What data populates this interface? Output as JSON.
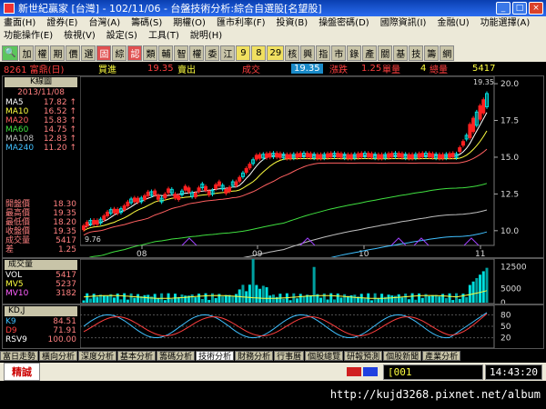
{
  "window": {
    "title": "新世紀贏家 [台灣] - 102/11/06 - 台盤技術分析:綜合自選股[名望股]",
    "min": "_",
    "max": "□",
    "close": "×"
  },
  "menu": [
    "畫面(H)",
    "證券(E)",
    "台灣(A)",
    "籌碼(S)",
    "期權(O)",
    "匯市利率(F)",
    "投資(B)",
    "操盤密碼(D)",
    "國際資訊(I)",
    "金融(U)",
    "功能選擇(A)",
    "功能操作(E)",
    "檢視(V)",
    "設定(S)",
    "工具(T)",
    "說明(H)"
  ],
  "toolbar": [
    "🔍",
    "加",
    "權",
    "期",
    "價",
    "選",
    "固",
    "綜",
    "認",
    "類",
    "輔",
    "智",
    "權",
    "委",
    "江",
    "9",
    "8",
    "29",
    "核",
    "興",
    "指",
    "市",
    "錄",
    "產",
    "關",
    "基",
    "技",
    "籌",
    "網"
  ],
  "quote": {
    "code_name": "8261 富鼎(日)",
    "buy_label": "買進",
    "buy": "19.35",
    "sell_label": "賣出",
    "change_label": "成交",
    "trade": "19.35",
    "change_label2": "漲跌",
    "change": "1.25",
    "vol_label": "單量",
    "vol": "4",
    "total_label": "總量",
    "total": "5417"
  },
  "colors": {
    "ma5": "#ffffff",
    "ma10": "#ffff40",
    "ma20": "#ff6060",
    "ma60": "#40e040",
    "ma108": "#c0c0c0",
    "ma240": "#40c0ff",
    "up": "#ff2020",
    "down": "#00e0e0",
    "k": "#40c0ff",
    "d": "#ff4040"
  },
  "kline": {
    "title": "K線圖",
    "date": "2013/11/08",
    "mas": [
      {
        "name": "MA5",
        "value": "17.82",
        "dir": "↑"
      },
      {
        "name": "MA10",
        "value": "16.52",
        "dir": "↑"
      },
      {
        "name": "MA20",
        "value": "15.83",
        "dir": "↑"
      },
      {
        "name": "MA60",
        "value": "14.75",
        "dir": "↑"
      },
      {
        "name": "MA108",
        "value": "12.83",
        "dir": "↑"
      },
      {
        "name": "MA240",
        "value": "11.20",
        "dir": "↑"
      }
    ],
    "ohlc": [
      {
        "name": "開盤價",
        "value": "18.30"
      },
      {
        "name": "最高價",
        "value": "19.35"
      },
      {
        "name": "最低價",
        "value": "18.20"
      },
      {
        "name": "收盤價",
        "value": "19.35"
      },
      {
        "name": "成交量",
        "value": "5417"
      },
      {
        "name": "差",
        "value": "1.25"
      }
    ],
    "low_mark": "9.76",
    "high_mark": "19.35",
    "y_ticks": [
      "20.0",
      "17.5",
      "15.0",
      "12.5",
      "10.0"
    ],
    "x_ticks": [
      "08",
      "09",
      "10",
      "11"
    ]
  },
  "volume": {
    "title": "成交量",
    "rows": [
      {
        "name": "VOL",
        "value": "5417"
      },
      {
        "name": "MV5",
        "value": "5237"
      },
      {
        "name": "MV10",
        "value": "3182"
      }
    ],
    "y_ticks": [
      "12500",
      "5000",
      "0"
    ]
  },
  "kd": {
    "title": "KD,J",
    "rows": [
      {
        "name": "K9",
        "value": "84.51"
      },
      {
        "name": "D9",
        "value": "71.91"
      },
      {
        "name": "RSV9",
        "value": "100.00"
      }
    ],
    "y_ticks": [
      "80",
      "50",
      "20"
    ]
  },
  "tabs": [
    "富日走勢",
    "橫向分析",
    "深度分析",
    "基本分析",
    "籌碼分析",
    "技術分析",
    "財務分析",
    "行事曆",
    "個股總覽",
    "研報預測",
    "個股新聞",
    "產業分析"
  ],
  "active_tab": "技術分析",
  "status": {
    "left": "精誠",
    "code": "001",
    "time": "14:43:20"
  },
  "footer_url": "http://kujd3268.pixnet.net/album"
}
